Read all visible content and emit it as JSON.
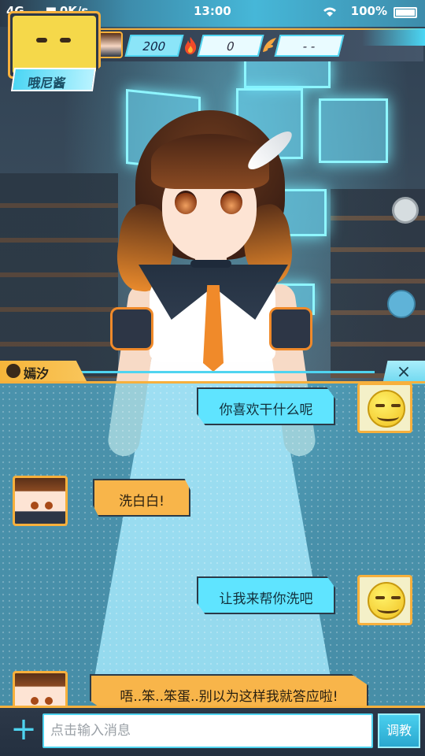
{
  "status_bar": {
    "network": "4G",
    "speed": "0K/s",
    "time": "13:00",
    "battery": "100%"
  },
  "profile": {
    "name": "哦尼酱",
    "stats": {
      "coins": "200",
      "fire": "0",
      "wing": "- -"
    }
  },
  "chat": {
    "partner_name": "嫣汐",
    "close_label": "×",
    "messages": [
      {
        "sender": "me",
        "text": "你喜欢干什么呢"
      },
      {
        "sender": "her",
        "text": "洗白白!"
      },
      {
        "sender": "me",
        "text": "让我来帮你洗吧"
      },
      {
        "sender": "her",
        "text": "唔..笨..笨蛋..别以为这样我就答应啦!"
      }
    ]
  },
  "input_bar": {
    "plus_label": "+",
    "placeholder": "点击输入消息",
    "value": "",
    "teach_label": "调教"
  },
  "colors": {
    "accent_orange": "#f7b03c",
    "accent_cyan": "#4fd4f0",
    "my_bubble": "#5fe4ff",
    "her_bubble": "#f8b54a"
  },
  "icons": {
    "fire": "fire-icon",
    "wing": "wing-icon",
    "plus": "plus-icon",
    "close": "close-icon",
    "wifi": "wifi-icon",
    "battery": "battery-icon"
  }
}
